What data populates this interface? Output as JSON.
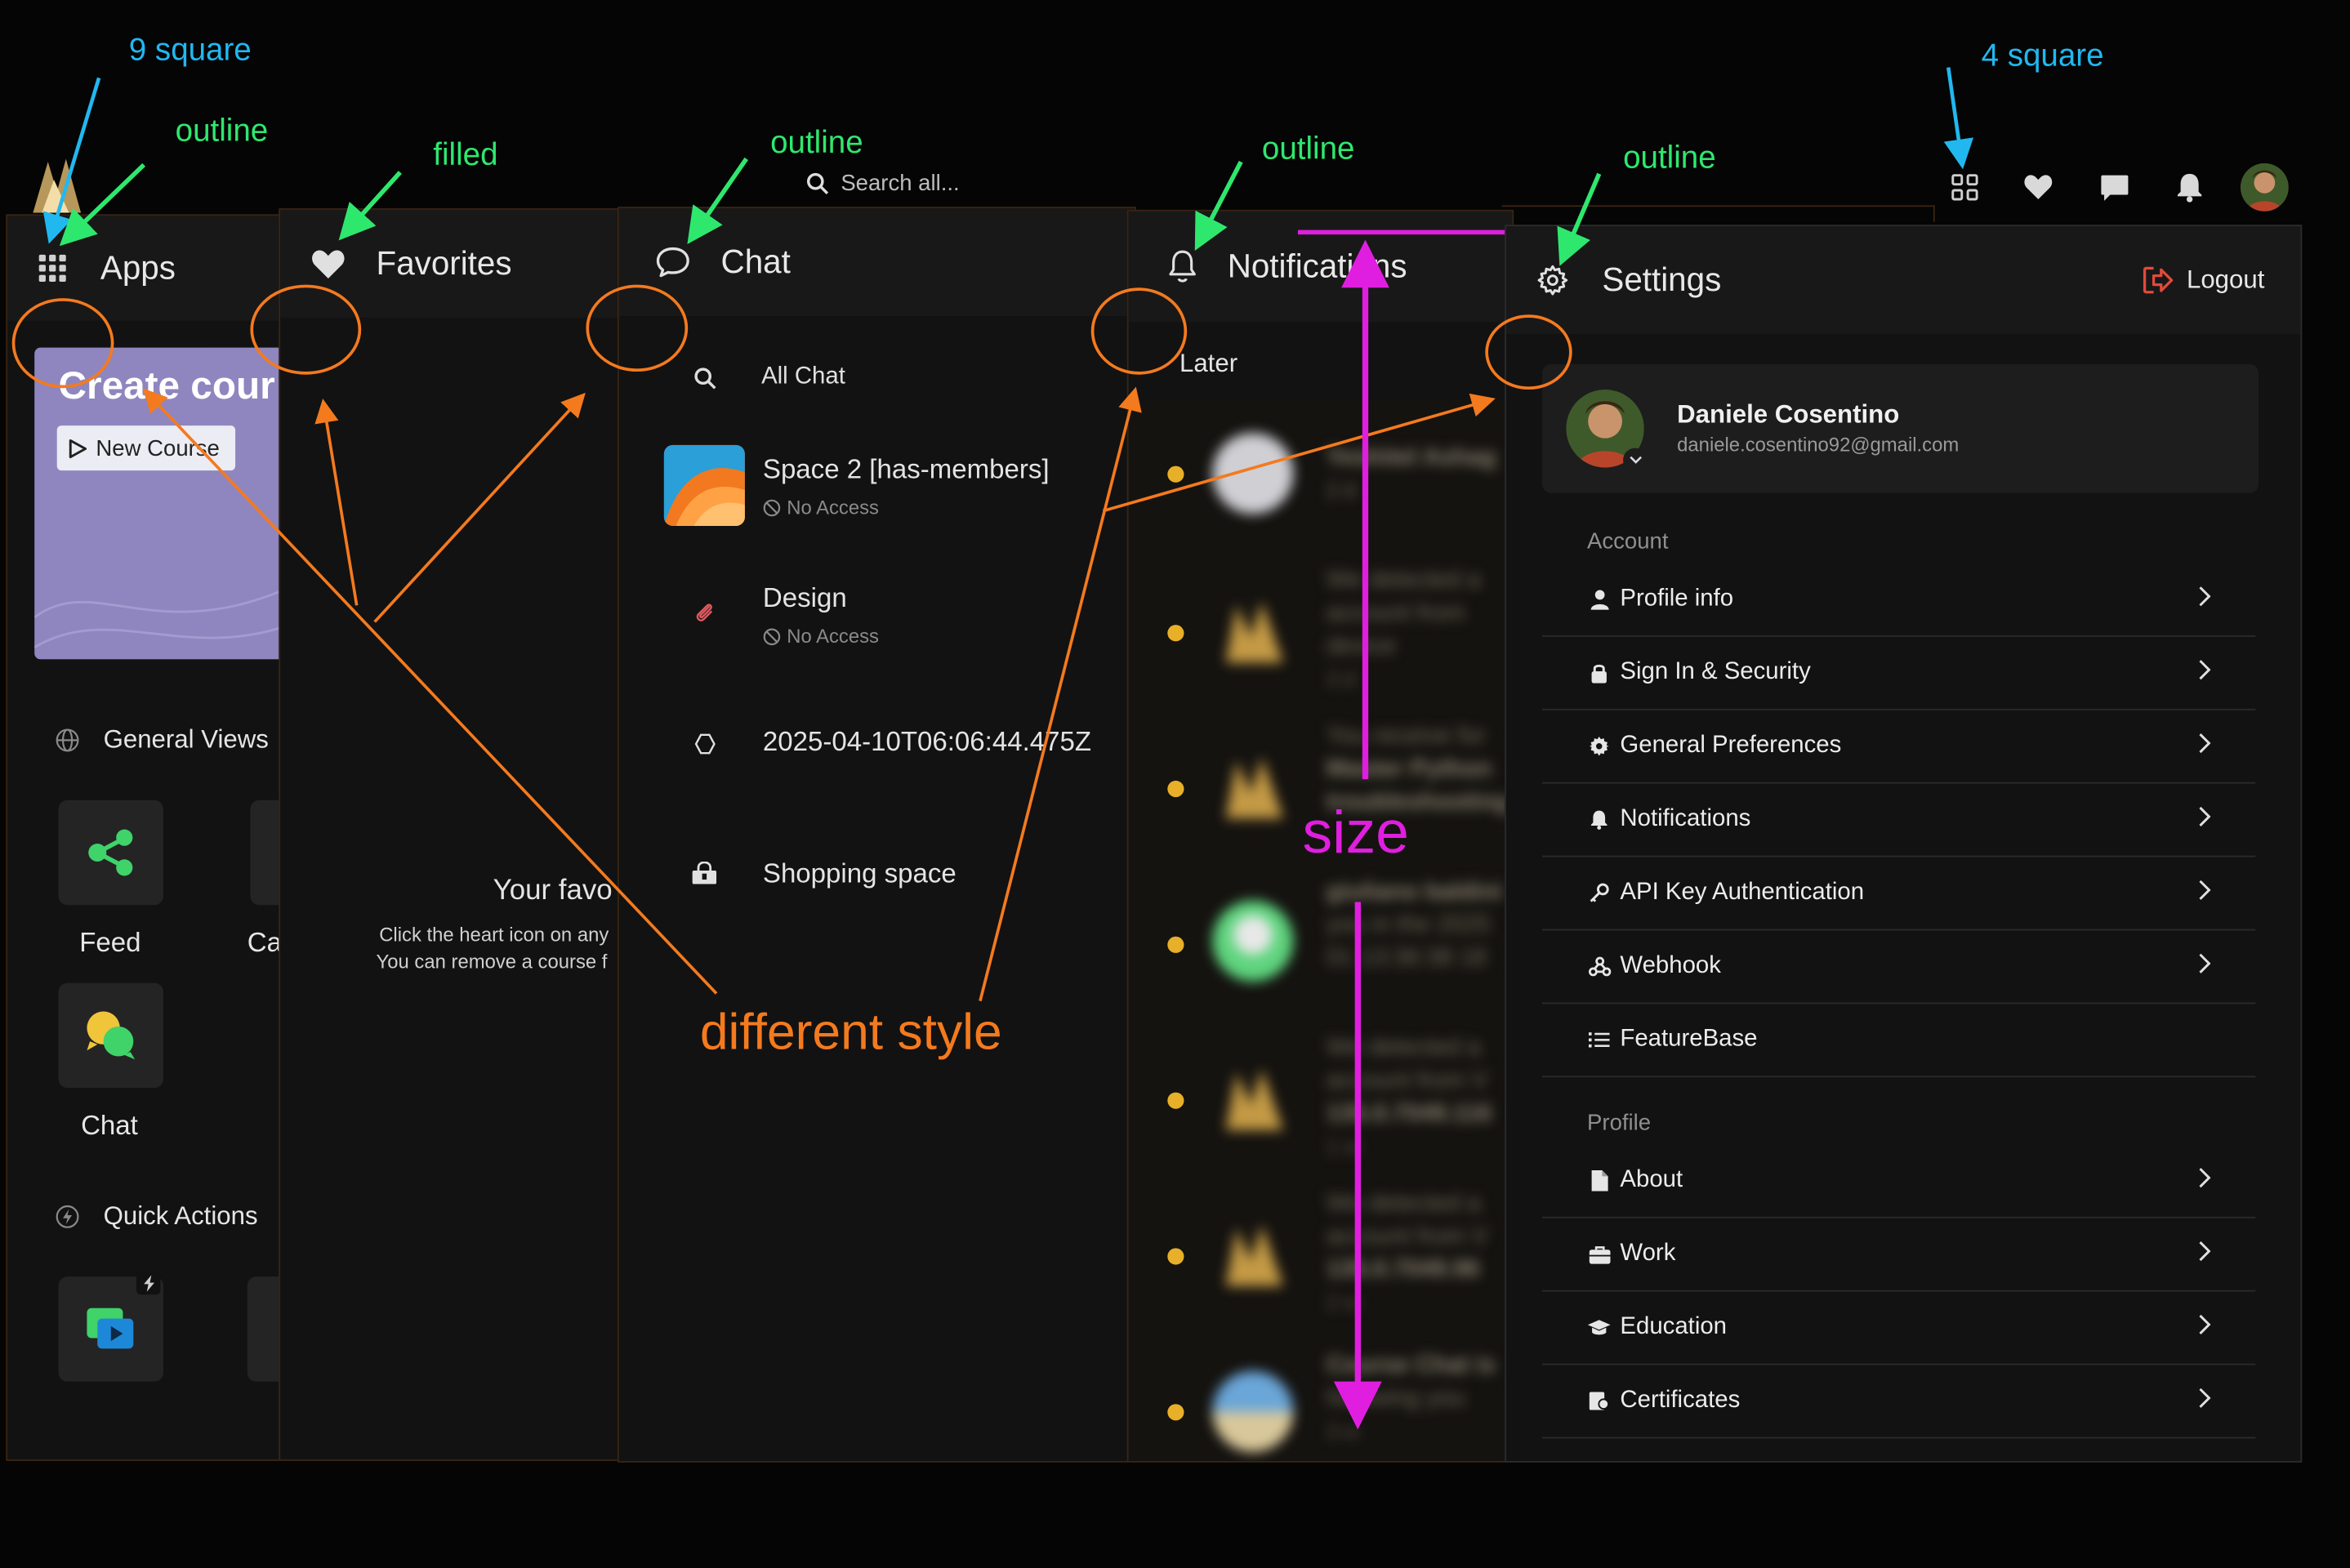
{
  "topbar": {
    "search_placeholder": "Search all...",
    "icons": [
      "grid-icon",
      "heart-icon",
      "message-icon",
      "bell-icon",
      "avatar"
    ]
  },
  "apps_panel": {
    "title": "Apps",
    "promo": {
      "title": "Create cour",
      "button_label": "New Course"
    },
    "general_views_label": "General Views",
    "tiles": [
      {
        "label": "Feed",
        "icon": "share-icon"
      },
      {
        "label": "Ca",
        "icon": "calendar-icon"
      },
      {
        "label": "Chat",
        "icon": "chat-bubbles-icon"
      }
    ],
    "quick_actions_label": "Quick Actions"
  },
  "favorites_panel": {
    "title": "Favorites",
    "empty_title": "Your favo",
    "empty_line1": "Click the heart icon on any",
    "empty_line2": "You can remove a course f"
  },
  "chat_panel": {
    "title": "Chat",
    "all_chat_label": "All Chat",
    "items": [
      {
        "title": "Space 2 [has-members]",
        "subtitle": "No Access",
        "icon": "space-thumbnail"
      },
      {
        "title": "Design",
        "subtitle": "No Access",
        "icon": "paperclip-icon"
      },
      {
        "title": "2025-04-10T06:06:44.475Z",
        "subtitle": "",
        "icon": "hexagon-icon"
      },
      {
        "title": "Shopping space",
        "subtitle": "",
        "icon": "shop-icon"
      }
    ]
  },
  "notifications_panel": {
    "title": "Notifications",
    "later_label": "Later",
    "blurred_rows": [
      {
        "lines": [
          "Yeshitel Ashag",
          "2 d"
        ]
      },
      {
        "lines": [
          "We detected a",
          "account from",
          "device",
          "3 d"
        ]
      },
      {
        "lines": [
          "You receive for",
          "Master Python",
          "troubleshooting lo"
        ]
      },
      {
        "lines": [
          "giuliano baldini",
          "you in the 2025",
          "01 13:36:38 18"
        ]
      },
      {
        "lines": [
          "We detected a",
          "account from V",
          "135.0.7049.116",
          "1 w"
        ]
      },
      {
        "lines": [
          "We detected a",
          "account from V",
          "135.0.7049.96",
          "2 w"
        ]
      },
      {
        "lines": [
          "Course Chat is",
          "following you",
          "3 w"
        ]
      }
    ]
  },
  "settings_panel": {
    "title": "Settings",
    "logout_label": "Logout",
    "user": {
      "name": "Daniele Cosentino",
      "email": "daniele.cosentino92@gmail.com"
    },
    "account_label": "Account",
    "account_items": [
      {
        "label": "Profile info",
        "icon": "user-icon",
        "chevron": true
      },
      {
        "label": "Sign In & Security",
        "icon": "lock-icon",
        "chevron": true
      },
      {
        "label": "General Preferences",
        "icon": "gear-icon",
        "chevron": true
      },
      {
        "label": "Notifications",
        "icon": "bell-icon",
        "chevron": true
      },
      {
        "label": "API Key Authentication",
        "icon": "key-icon",
        "chevron": true
      },
      {
        "label": "Webhook",
        "icon": "webhook-icon",
        "chevron": true
      },
      {
        "label": "FeatureBase",
        "icon": "list-icon",
        "chevron": false
      }
    ],
    "profile_label": "Profile",
    "profile_items": [
      {
        "label": "About",
        "icon": "document-icon",
        "chevron": true
      },
      {
        "label": "Work",
        "icon": "briefcase-icon",
        "chevron": true
      },
      {
        "label": "Education",
        "icon": "graduation-cap-icon",
        "chevron": true
      },
      {
        "label": "Certificates",
        "icon": "certificate-icon",
        "chevron": true
      }
    ]
  },
  "annotations": {
    "nine_square": "9 square",
    "four_square": "4 square",
    "outline": "outline",
    "filled": "filled",
    "different_style": "different style",
    "size": "size",
    "colors": {
      "blue": "#21b8f0",
      "green": "#2ee86e",
      "orange": "#f47a1e",
      "magenta": "#e01ee0"
    }
  }
}
